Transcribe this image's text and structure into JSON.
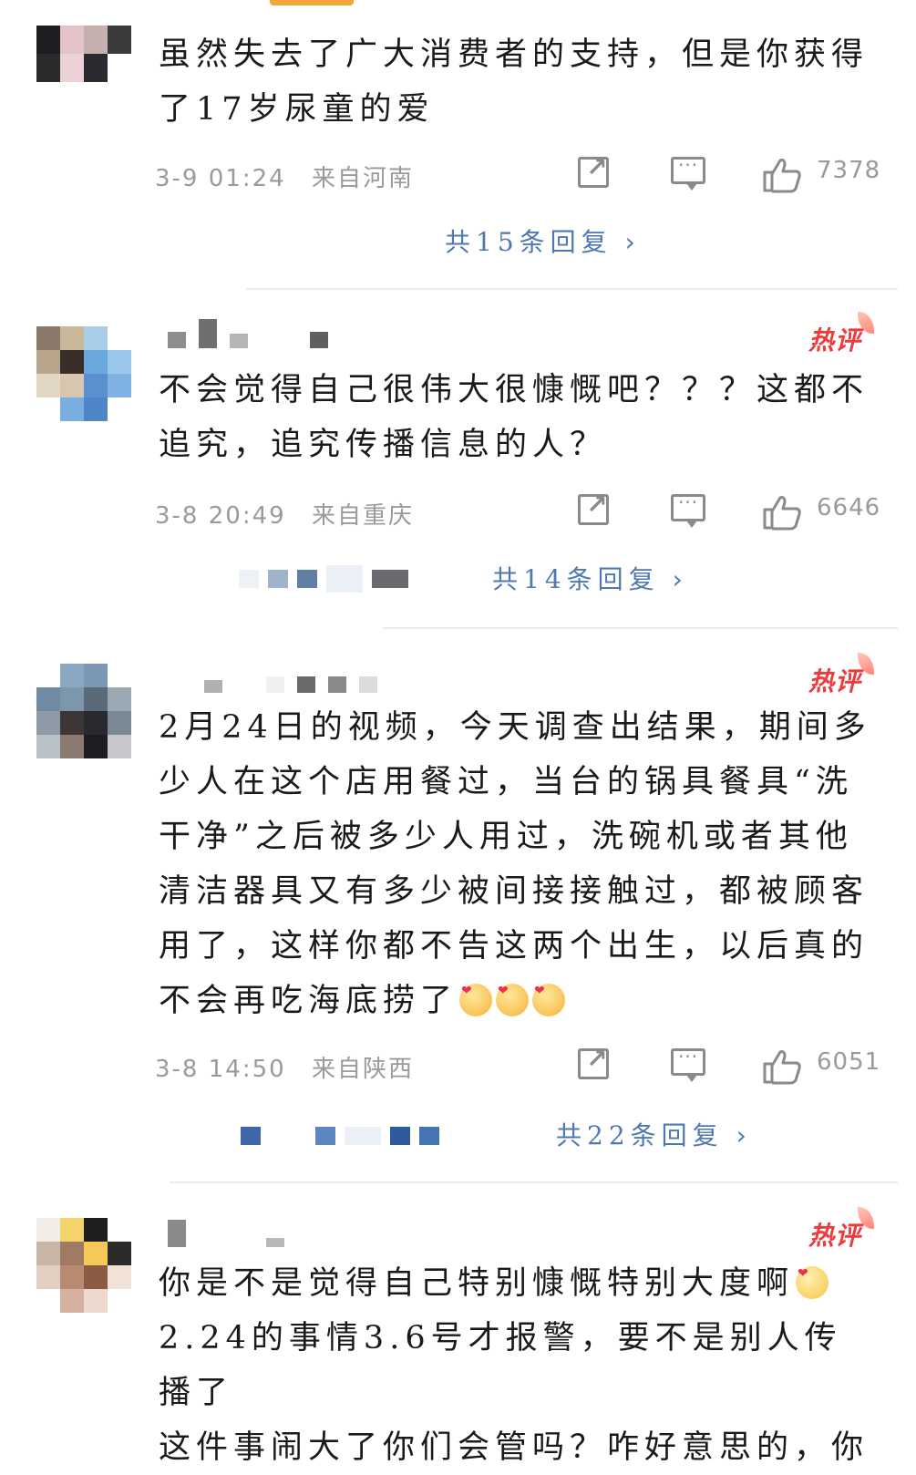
{
  "comments": [
    {
      "text": "虽然失去了广大消费者的支持，但是你获得了17岁尿童的爱",
      "time": "3-9 01:24",
      "location": "来自河南",
      "likes": "7378",
      "replies": "共15条回复",
      "hot": false
    },
    {
      "text": "不会觉得自己很伟大很慷慨吧？？？这都不追究，追究传播信息的人？",
      "time": "3-8 20:49",
      "location": "来自重庆",
      "likes": "6646",
      "replies": "共14条回复",
      "hot": true,
      "badge": "热评"
    },
    {
      "text": "2月24日的视频，今天调查出结果，期间多少人在这个店用餐过，当台的锅具餐具“洗干净”之后被多少人用过，洗碗机或者其他清洁器具又有多少被间接接触过，都被顾客用了，这样你都不告这两个出生，以后真的不会再吃海底捞了",
      "time": "3-8 14:50",
      "location": "来自陕西",
      "likes": "6051",
      "replies": "共22条回复",
      "hot": true,
      "badge": "热评"
    },
    {
      "text_line1": "你是不是觉得自己特别慷慨特别大度啊",
      "text_line2": "2.24的事情3.6号才报警，要不是别人传播了",
      "text_line3": "这件事闹大了你们会管吗？咋好意思的，你",
      "hot": true,
      "badge": "热评"
    }
  ],
  "colors": {
    "accent_link": "#4f78b3",
    "hot_badge": "#ee3b3b",
    "meta_gray": "#9a9a9a"
  },
  "icons": [
    "share-icon",
    "comment-icon",
    "like-icon",
    "chevron-right-icon"
  ]
}
